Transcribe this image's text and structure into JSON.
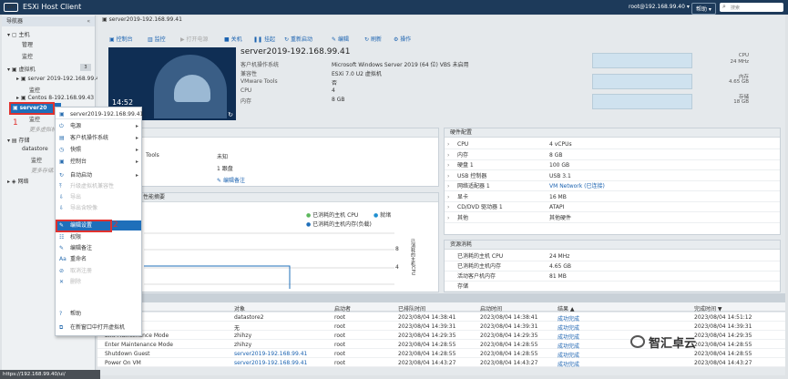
{
  "app": {
    "logo": "vm",
    "title": "ESXi Host Client",
    "user": "root@192.168.99.40 ▾",
    "help": "帮助 ▾",
    "search_placeholder": "搜索"
  },
  "nav": {
    "title": "导航器",
    "host": "主机",
    "manage": "管理",
    "monitor": "监控",
    "vms": "虚拟机",
    "vm_count": "3",
    "vm1": "server 2019-192.168.99.4",
    "vm1_monitor": "监控",
    "vm2": "Centos 8-192.168.99.43",
    "vm3": "server20",
    "vm3_monitor": "监控",
    "more_vms": "更多虚拟机...",
    "storage": "存储",
    "datastore": "datastore",
    "storage_monitor": "监控",
    "more_storage": "更多存储...",
    "network": "网络"
  },
  "annotations": {
    "one": "1",
    "two": "2"
  },
  "vm": {
    "header": "server2019-192.168.99.41",
    "name": "server2019-192.168.99.41",
    "thumb_time": "14:52",
    "props": [
      {
        "k": "客户机操作系统",
        "v": "Microsoft Windows Server 2019 (64 位) VBS 未启用"
      },
      {
        "k": "兼容性",
        "v": "ESXi 7.0 U2 虚拟机"
      },
      {
        "k": "VMware Tools",
        "v": "否"
      },
      {
        "k": "CPU",
        "v": "4"
      },
      {
        "k": "内存",
        "v": "8 GB"
      }
    ],
    "resources": [
      {
        "label": "CPU",
        "value": "24 MHz"
      },
      {
        "label": "内存",
        "value": "4.65 GB"
      },
      {
        "label": "存储",
        "value": "18 GB"
      }
    ]
  },
  "toolbar": {
    "console": "控制台",
    "monitor": "监控",
    "power_on": "打开电源",
    "shutdown": "关机",
    "suspend": "挂起",
    "restart": "重新启动",
    "edit": "编辑",
    "refresh": "刷新",
    "actions": "操作"
  },
  "general": {
    "tools": "Tools",
    "tools_val": "未知",
    "row2_val": "1 跟盘",
    "notes_link": "编辑备注"
  },
  "perf": {
    "title": "性能摘要",
    "leg1": "已消耗的主机 CPU",
    "leg2": "就绪",
    "leg3": "已消耗的主机内存(负载)",
    "y8": "8",
    "y6": "6",
    "y4": "4",
    "y2": "2",
    "axis": "已消耗的主机CPU"
  },
  "hardware": {
    "title": "硬件配置",
    "rows": [
      {
        "k": "CPU",
        "v": "4 vCPUs"
      },
      {
        "k": "内存",
        "v": "8 GB"
      },
      {
        "k": "硬盘 1",
        "v": "100 GB"
      },
      {
        "k": "USB 控制器",
        "v": "USB 3.1"
      },
      {
        "k": "网络适配器 1",
        "v": "VM Network (已连接)"
      },
      {
        "k": "显卡",
        "v": "16 MB"
      },
      {
        "k": "CD/DVD 驱动器 1",
        "v": "ATAPI"
      },
      {
        "k": "其他",
        "v": "其他硬件"
      }
    ]
  },
  "resources_panel": {
    "title": "资源消耗",
    "rows": [
      {
        "k": "已消耗的主机 CPU",
        "v": "24 MHz"
      },
      {
        "k": "已消耗的主机内存",
        "v": "4.65 GB"
      },
      {
        "k": "活动客户机内存",
        "v": "81 MB"
      },
      {
        "k": "存储",
        "v": ""
      }
    ]
  },
  "context_menu": {
    "header": "server2019-192.168.99.41",
    "items": [
      {
        "label": "电源",
        "sub": true,
        "dis": false
      },
      {
        "label": "客户机操作系统",
        "sub": true,
        "dis": false
      },
      {
        "label": "快照",
        "sub": true,
        "dis": false
      },
      {
        "label": "控制台",
        "sub": true,
        "dis": false
      },
      {
        "label": "自动启动",
        "sub": true,
        "dis": false
      },
      {
        "label": "升级虚拟机兼容性",
        "sub": false,
        "dis": true
      },
      {
        "label": "导出",
        "sub": false,
        "dis": true
      },
      {
        "label": "导出含映像",
        "sub": false,
        "dis": true
      },
      {
        "label": "编辑设置",
        "sub": false,
        "dis": false
      },
      {
        "label": "权限",
        "sub": false,
        "dis": false
      },
      {
        "label": "编辑备注",
        "sub": false,
        "dis": false
      },
      {
        "label": "重命名",
        "sub": false,
        "dis": false
      },
      {
        "label": "取消注册",
        "sub": false,
        "dis": true
      },
      {
        "label": "删除",
        "sub": false,
        "dis": true
      },
      {
        "label": "帮助",
        "sub": false,
        "dis": false
      },
      {
        "label": "在新窗口中打开虚拟机",
        "sub": false,
        "dis": false
      }
    ]
  },
  "tasks": {
    "headers": [
      "对象",
      "启动者",
      "已排队时间",
      "启动时间",
      "结果 ▲",
      "完成时间 ▼"
    ],
    "rows": [
      {
        "task": "",
        "obj": "datastore2",
        "by": "root",
        "queued": "2023/08/04 14:38:41",
        "start": "2023/08/04 14:38:41",
        "result": "成功完成",
        "done": "2023/08/04 14:51:12"
      },
      {
        "task": "Path",
        "obj": "无",
        "by": "root",
        "queued": "2023/08/04 14:39:31",
        "start": "2023/08/04 14:39:31",
        "result": "成功完成",
        "done": "2023/08/04 14:39:31"
      },
      {
        "task": "Exit Maintenance Mode",
        "obj": "zhihzy",
        "by": "root",
        "queued": "2023/08/04 14:29:35",
        "start": "2023/08/04 14:29:35",
        "result": "成功完成",
        "done": "2023/08/04 14:29:35"
      },
      {
        "task": "Enter Maintenance Mode",
        "obj": "zhihzy",
        "by": "root",
        "queued": "2023/08/04 14:28:55",
        "start": "2023/08/04 14:28:55",
        "result": "成功完成",
        "done": "2023/08/04 14:28:55"
      },
      {
        "task": "Shutdown Guest",
        "obj": "server2019-192.168.99.41",
        "by": "root",
        "queued": "2023/08/04 14:28:55",
        "start": "2023/08/04 14:28:55",
        "result": "成功完成",
        "done": "2023/08/04 14:28:55"
      },
      {
        "task": "Power On VM",
        "obj": "server2019-192.168.99.41",
        "by": "root",
        "queued": "2023/08/04 14:43:27",
        "start": "2023/08/04 14:43:27",
        "result": "成功完成",
        "done": "2023/08/04 14:43:27"
      }
    ]
  },
  "status": {
    "url": "https://192.168.99.40/ui/"
  },
  "watermark": {
    "text": "智汇卓云"
  },
  "colors": {
    "accent": "#1f6fba",
    "topbar": "#1d3a5a",
    "annotation": "#e0322f",
    "success": "#2e9e44"
  }
}
